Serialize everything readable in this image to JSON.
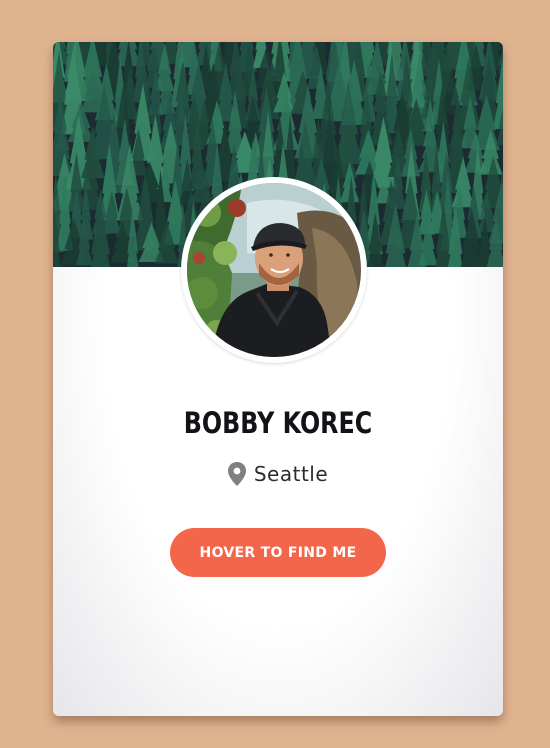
{
  "profile": {
    "name": "BOBBY KOREC",
    "location": "Seattle",
    "button_label": "HOVER TO FIND ME"
  },
  "icons": {
    "location": "map-pin-icon"
  },
  "colors": {
    "page_background": "#e0b38f",
    "card_background": "#ffffff",
    "banner_dark": "#1d2a33",
    "accent_button": "#f4664a",
    "name_text": "#111317",
    "pin_icon": "#808080"
  }
}
